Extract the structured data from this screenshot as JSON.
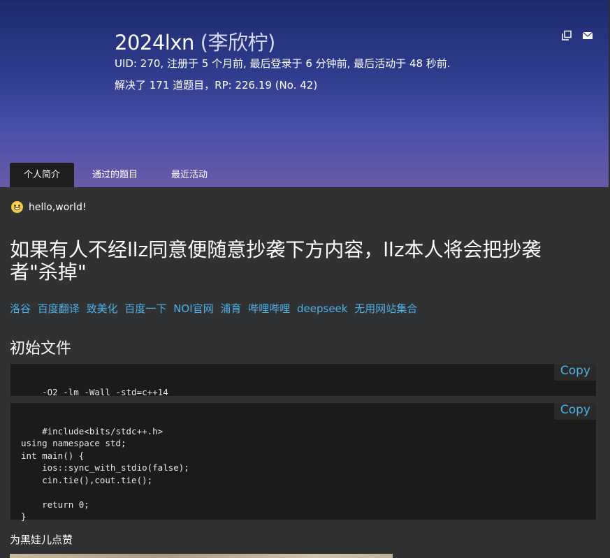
{
  "header": {
    "username": "2024lxn",
    "realname": "(李欣柠)",
    "meta": "UID: 270, 注册于 5 个月前, 最后登录于 6 分钟前, 最后活动于 48 秒前.",
    "stats": "解决了 171 道题目，RP: 226.19 (No. 42)",
    "icons": [
      "copy-icon",
      "mail-icon"
    ]
  },
  "tabs": [
    {
      "label": "个人简介",
      "active": true
    },
    {
      "label": "通过的题目",
      "active": false
    },
    {
      "label": "最近活动",
      "active": false
    }
  ],
  "content": {
    "status_text": "hello,world!",
    "warning": "如果有人不经llz同意便随意抄袭下方内容，llz本人将会把抄袭者\"杀掉\"",
    "links": [
      "洛谷",
      "百度翻译",
      "致美化",
      "百度一下",
      "NOI官网",
      "浦育",
      "哔哩哔哩",
      "deepseek",
      "无用网站集合"
    ],
    "section_title": "初始文件",
    "code_blocks": [
      {
        "code": "-O2 -lm -Wall -std=c++14",
        "copy_label": "Copy"
      },
      {
        "code": "#include<bits/stdc++.h>\nusing namespace std;\nint main() {\n    ios::sync_with_stdio(false);\n    cin.tie(),cout.tie();\n\n    return 0;\n}",
        "copy_label": "Copy"
      }
    ],
    "likes_text": "为黑娃儿点赞"
  },
  "colors": {
    "link": "#4fb0e8",
    "background": "#303133",
    "code_background": "#1b1b1b"
  }
}
